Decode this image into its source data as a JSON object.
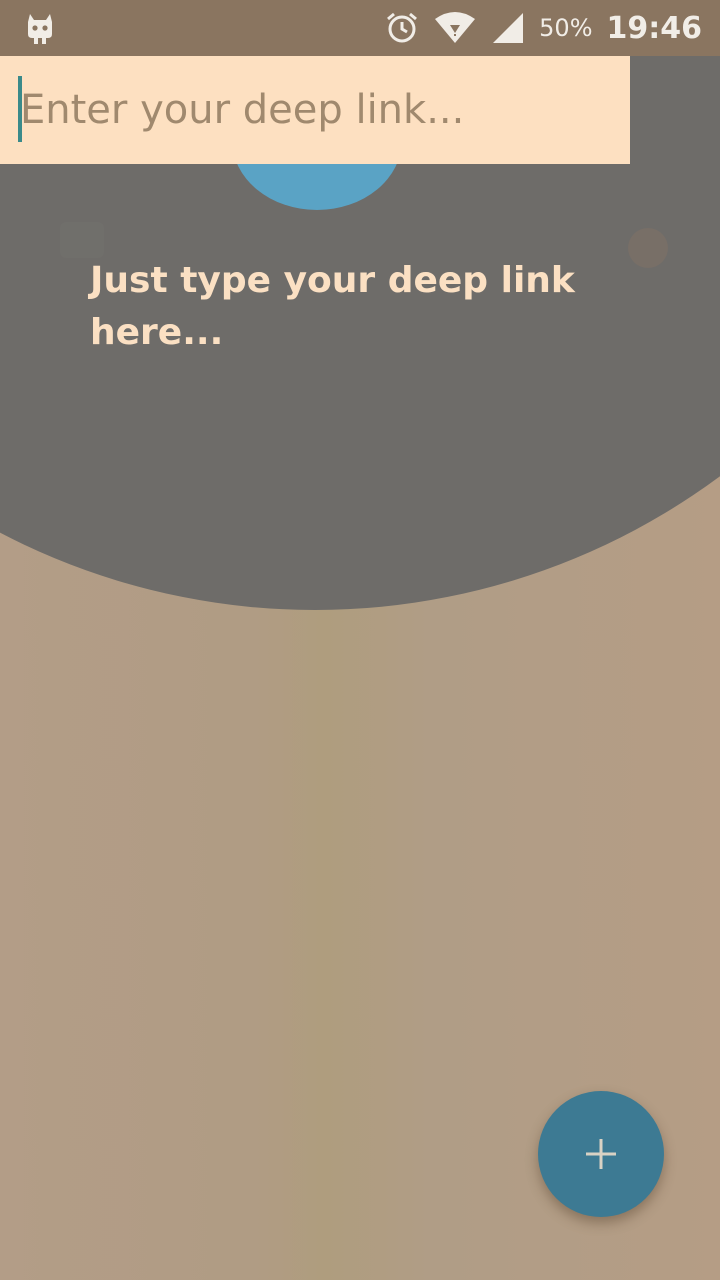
{
  "status_bar": {
    "battery_percent": "50%",
    "time": "19:46",
    "icons": [
      "cyanogen-mascot-icon",
      "alarm-icon",
      "wifi-icon",
      "cell-signal-icon"
    ]
  },
  "deep_link": {
    "placeholder": "Enter your deep link...",
    "value": ""
  },
  "showcase": {
    "message": "Just type your deep link here..."
  },
  "fab": {
    "icon": "plus-icon"
  },
  "colors": {
    "status_bar": "#8a7560",
    "input_bg": "#fde0c1",
    "overlay": "#6e6c69",
    "highlight": "#5aa3c5",
    "fab": "#3d7a93",
    "showcase_text": "#fbe0c3"
  }
}
